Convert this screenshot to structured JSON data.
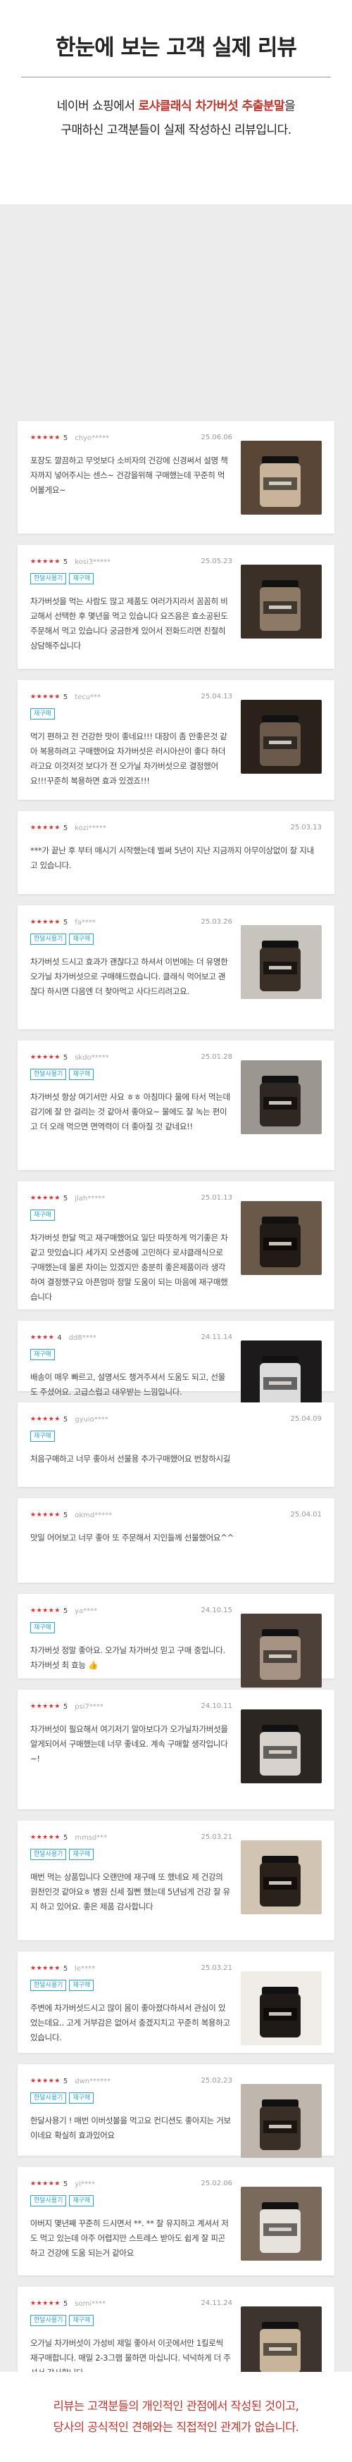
{
  "header": {
    "title": "한눈에 보는 고객 실제 리뷰",
    "line1_pre": "네이버 쇼핑에서 ",
    "line1_hl": "로샤클래식 차가버섯 추출분말",
    "line1_post": "을",
    "line2": "구매하신 고객분들이 실제 작성하신 리뷰입니다."
  },
  "reviews": [
    {
      "stars": "★★★★★",
      "score": "5",
      "user": "chyo*****",
      "date": "25.06.06",
      "badges": [],
      "text": "포장도 깔끔하고 무엇보다 소비자의 건강에 신경써서 설명 책자까지 넣어주시는 센스~ 건강을위해 구매했는데 꾸준히 먹어볼게요~",
      "thumb": "jar-hand"
    },
    {
      "stars": "★★★★★",
      "score": "5",
      "user": "kosi3*****",
      "date": "25.05.23",
      "badges": [
        "한달사용기",
        "재구매"
      ],
      "text": "차가버섯을 먹는 사람도 많고 제품도 여러가지라서 꼼꼼히 비교해서 선택한 후 몇년을 먹고 있습니다 요즈음은 효소공된도 주문해서 먹고 있습니다 궁금한게 있어서 전화드리면 친절히 상담해주십니다",
      "thumb": "jar-stack"
    },
    {
      "stars": "★★★★★",
      "score": "5",
      "user": "tecu***",
      "date": "25.04.13",
      "badges": [
        "재구매"
      ],
      "text": "먹기 편하고 전 건강한 맛이 좋네요!!! 대장이 좀 안좋은것 같아 복용하려고 구매했어요 차가버섯은 러시아산이 좋다 하더라고요 이것저것 보다가 전 오가닐 차가버섯으로 결정했어요!!!꾸준히 복용하면 효과 있겠죠!!!",
      "thumb": "jar-dark"
    },
    {
      "stars": "★★★★★",
      "score": "5",
      "user": "kozi*****",
      "date": "25.03.13",
      "badges": [],
      "text": "***가 끝난 후 부터 매시기 시작했는데 벌써 5년이 지난 지금까지 아무이상없이 잘 지내고 있습니다.",
      "thumb": ""
    },
    {
      "stars": "★★★★★",
      "score": "5",
      "user": "fa****",
      "date": "25.03.26",
      "badges": [
        "한달사용기",
        "재구매"
      ],
      "text": "차가버섯 드시고 효과가 괜찮다고 하셔서 이번에는 더 유명한 오가닐 차가버섯으로 구매해드렸습니다. 클래식 먹어보고 괜찮다 하시면 다음엔 더 찾아먹고 사다드리려고요.",
      "thumb": "jar-box"
    },
    {
      "stars": "★★★★★",
      "score": "5",
      "user": "skdo*****",
      "date": "25.01.28",
      "badges": [
        "한달사용기",
        "재구매"
      ],
      "text": "차가버섯 항상 여기서만 사요 ㅎㅎ 아침마다 물에 타서 먹는데 감기에 잘 안 걸리는 것 같아서 좋아요~ 물에도 잘 녹는 편이고 더 오래 먹으면 면역력이 더 좋아질 것 같네요!!",
      "thumb": "jar-box2"
    },
    {
      "stars": "★★★★★",
      "score": "5",
      "user": "jlah*****",
      "date": "25.01.13",
      "badges": [
        "재구매"
      ],
      "text": "차가버섯 한달 먹고 재구매했어요 일단 따뜻하게 먹기좋은 차 같고 맛있습니다 세가지 오션중에 고민하다 로샤클래식으로 구매했는데 물론 차이는 있겠지만 충분히 좋은제품이라 생각하여 결정했구요 아픈엄마 정말 도움이 되는 마음에 재구매했습니다",
      "thumb": "jar-hand2"
    },
    {
      "stars": "★★★★",
      "score": "4",
      "user": "dd8****",
      "date": "24.11.14",
      "badges": [
        "재구매"
      ],
      "text": "배송이 매우 빠르고, 설명서도 챙겨주셔서 도움도 되고, 선물도 주셨어요. 고급스럽고 대우받는 느낌입니다.",
      "thumb": "jar-gift"
    },
    {
      "stars": "★★★★★",
      "score": "5",
      "user": "gyuio****",
      "date": "25.04.09",
      "badges": [
        "재구매"
      ],
      "text": "처음구매하고 너무 좋아서 선물용 추가구매했어요 번창하시길",
      "thumb": ""
    },
    {
      "stars": "★★★★★",
      "score": "5",
      "user": "okmd*****",
      "date": "25.04.01",
      "badges": [],
      "text": "맛일 어어보고 너무 좋아 또 주문해서 지인들께 선물했어요^^",
      "thumb": ""
    },
    {
      "stars": "★★★★★",
      "score": "5",
      "user": "ya****",
      "date": "24.10.15",
      "badges": [
        "재구매"
      ],
      "text": "차가버섯 정말 좋아요. 오가닐 차가버섯 믿고 구매 중입니다. 차가버섯 최 효능 👍",
      "thumb": "jar-single"
    },
    {
      "stars": "★★★★★",
      "score": "5",
      "user": "psi7****",
      "date": "24.10.11",
      "badges": [],
      "text": "차가버섯이 필요해서 여기저기 알아보다가 오가닐차가버섯을 알게되어서 구매했는데 너무 좋네요. 계속 구매할 생각입니다~!",
      "thumb": "jar-single2"
    },
    {
      "stars": "★★★★★",
      "score": "5",
      "user": "mmsd***",
      "date": "25.03.21",
      "badges": [
        "한달사용기",
        "재구매"
      ],
      "text": "매번 먹는 상품입니다 오랜만에 재구매 또 했네요 제 건강의 원천인것 같아요ㅎ 병원 신세 질뻔 했는데 5년넘게 건강 잘 유지 하고 있어요. 좋은 제품 감사합니다",
      "thumb": "jar-table"
    },
    {
      "stars": "★★★★★",
      "score": "5",
      "user": "le****",
      "date": "25.03.21",
      "badges": [
        "한달사용기",
        "재구매"
      ],
      "text": "주변에 차가버섯드시고 많이 몸이 좋아졌다하셔서 관심이 있었는데요.. 고게 거부감은 없어서 충겠지치고 꾸준히 복용하고 있습니다.",
      "thumb": "jar-three"
    },
    {
      "stars": "★★★★★",
      "score": "5",
      "user": "dwn******",
      "date": "25.02.23",
      "badges": [
        "한달사용기",
        "재구매"
      ],
      "text": "한달사용기 ! 매번 이버섯볼을 먹고요 컨디션도 좋아지는 거보이네요 확실히 효과있어요",
      "thumb": "jar-spoon"
    },
    {
      "stars": "★★★★★",
      "score": "5",
      "user": "yi****",
      "date": "25.02.06",
      "badges": [
        "한달사용기",
        "재구매"
      ],
      "text": "아버지 몇년째 꾸준히 드시면서 **. ** 잘 유지하고 계셔서 저도 먹고 있는데 아주 어렵지만 스트레스 받아도 쉽게 잘 피곤하고 건강에 도움 되는거 같아요",
      "thumb": "jar-cup"
    },
    {
      "stars": "★★★★★",
      "score": "5",
      "user": "somi****",
      "date": "24.11.24",
      "badges": [
        "한달사용기",
        "재구매"
      ],
      "text": "오가닐 차가버섯이 가성비 제일 좋아서 이곳에서만 1킬로씩 재구매합니다. 매일 2-3그램 물하면 마십니다. 넉넉하게 더 주셔서 감사합니다",
      "thumb": "jar-open"
    }
  ],
  "footer": {
    "line1": "리뷰는 고객분들의 개인적인 관점에서 작성된 것이고,",
    "line2": "당사의 공식적인 견해와는 직접적인 관계가 없습니다."
  }
}
